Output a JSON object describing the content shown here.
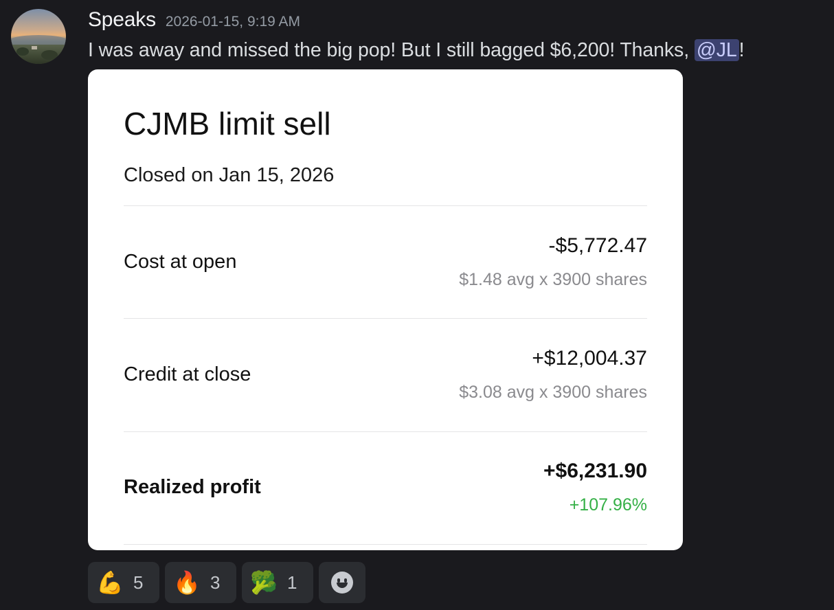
{
  "message": {
    "author": "Speaks",
    "timestamp": "2026-01-15, 9:19 AM",
    "text_before_mention": "I was away and missed the big pop! But I still bagged $6,200! Thanks, ",
    "mention": "@JL",
    "text_after_mention": "!"
  },
  "card": {
    "title": "CJMB limit sell",
    "subtitle": "Closed on Jan 15, 2026",
    "rows": [
      {
        "label": "Cost at open",
        "value": "-$5,772.47",
        "detail": "$1.48 avg x 3900 shares"
      },
      {
        "label": "Credit at close",
        "value": "+$12,004.37",
        "detail": "$3.08 avg x 3900 shares"
      },
      {
        "label": "Realized profit",
        "value": "+$6,231.90",
        "detail": "+107.96%"
      }
    ]
  },
  "reactions": [
    {
      "emoji": "💪",
      "icon": "flexed-biceps-icon",
      "count": "5"
    },
    {
      "emoji": "🔥",
      "icon": "fire-icon",
      "count": "3"
    },
    {
      "emoji": "🥦",
      "icon": "broccoli-icon",
      "count": "1"
    }
  ],
  "colors": {
    "background": "#1a1a1e",
    "mention_bg": "#3c4270",
    "mention_text": "#c9cdfb",
    "profit_green": "#35b046",
    "card_bg": "#ffffff"
  }
}
